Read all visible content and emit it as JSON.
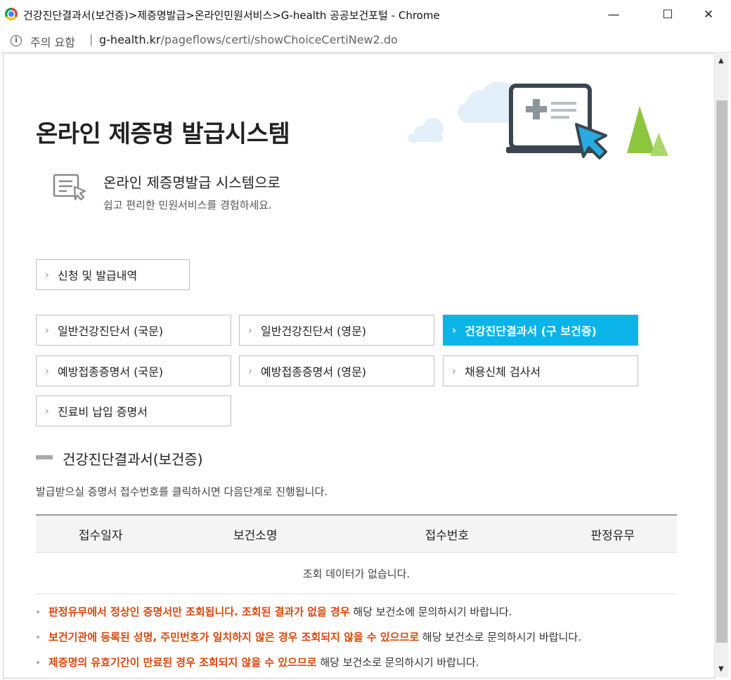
{
  "window": {
    "title": "건강진단결과서(보건증)>제증명발급>온라인민원서비스>G-health 공공보건포털 - Chrome",
    "minimize": "—",
    "maximize": "☐",
    "close": "✕"
  },
  "address": {
    "warning": "주의 요함",
    "separator": "|",
    "url_host": "g-health.kr",
    "url_path": "/pageflows/certi/showChoiceCertiNew2.do"
  },
  "page": {
    "main_title": "온라인 제증명 발급시스템",
    "intro_heading": "온라인 제증명발급 시스템으로",
    "intro_sub": "쉽고 편리한 민원서비스를 경험하세요."
  },
  "history_button": "신청 및 발급내역",
  "cert_buttons": [
    {
      "label": "일반건강진단서 (국문)"
    },
    {
      "label": "일반건강진단서 (영문)"
    },
    {
      "label": "건강진단결과서 (구 보건증)"
    },
    {
      "label": "예방접종증명서 (국문)"
    },
    {
      "label": "예방접종증명서 (영문)"
    },
    {
      "label": "채용신체 검사서"
    },
    {
      "label": "진료비 납입 증명서"
    }
  ],
  "section": {
    "title": "건강진단결과서(보건증)",
    "description": "발급받으실 증명서 접수번호를 클릭하시면 다음단계로 진행됩니다."
  },
  "table": {
    "headers": [
      "접수일자",
      "보건소명",
      "접수번호",
      "판정유무"
    ],
    "empty_message": "조회 데이터가 없습니다."
  },
  "notes": [
    {
      "highlight": "판정유무에서 정상인 증명서만 조회됩니다. 조회된 결과가 없을 경우",
      "rest": " 해당 보건소에 문의하시기 바랍니다."
    },
    {
      "highlight": "보건기관에 등록된 성명, 주민번호가 일치하지 않은 경우 조회되지 않을 수 있으므로",
      "rest": " 해당 보건소로 문의하시기 바랍니다."
    },
    {
      "highlight": "제증명의 유효기간이 만료된 경우 조회되지 않을 수 있으므로",
      "rest": " 해당 보건소로 문의하시기 바랍니다."
    }
  ],
  "icons": {
    "chevron": "›",
    "scroll_up": "▲",
    "scroll_down": "▼",
    "info": "i"
  },
  "colors": {
    "active_button": "#0ab4e8",
    "highlight_text": "#d9480f",
    "illustration_green": "#8cc63f",
    "illustration_blue": "#29abe2",
    "illustration_dark": "#3a4550"
  }
}
